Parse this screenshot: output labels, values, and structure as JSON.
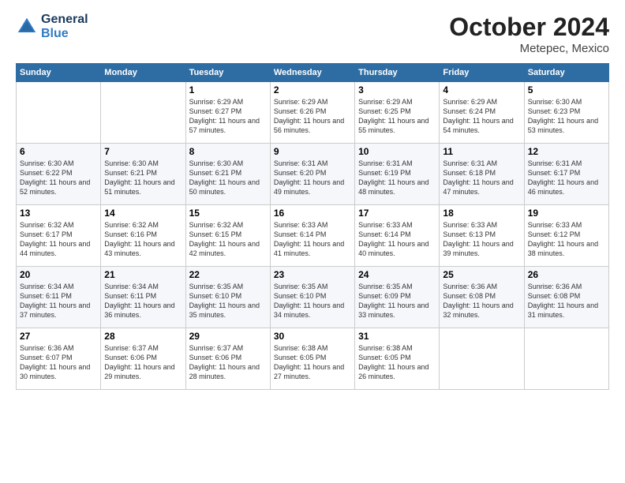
{
  "header": {
    "logo_line1": "General",
    "logo_line2": "Blue",
    "month": "October 2024",
    "location": "Metepec, Mexico"
  },
  "weekdays": [
    "Sunday",
    "Monday",
    "Tuesday",
    "Wednesday",
    "Thursday",
    "Friday",
    "Saturday"
  ],
  "weeks": [
    [
      {
        "day": "",
        "info": ""
      },
      {
        "day": "",
        "info": ""
      },
      {
        "day": "1",
        "info": "Sunrise: 6:29 AM\nSunset: 6:27 PM\nDaylight: 11 hours\nand 57 minutes."
      },
      {
        "day": "2",
        "info": "Sunrise: 6:29 AM\nSunset: 6:26 PM\nDaylight: 11 hours\nand 56 minutes."
      },
      {
        "day": "3",
        "info": "Sunrise: 6:29 AM\nSunset: 6:25 PM\nDaylight: 11 hours\nand 55 minutes."
      },
      {
        "day": "4",
        "info": "Sunrise: 6:29 AM\nSunset: 6:24 PM\nDaylight: 11 hours\nand 54 minutes."
      },
      {
        "day": "5",
        "info": "Sunrise: 6:30 AM\nSunset: 6:23 PM\nDaylight: 11 hours\nand 53 minutes."
      }
    ],
    [
      {
        "day": "6",
        "info": "Sunrise: 6:30 AM\nSunset: 6:22 PM\nDaylight: 11 hours\nand 52 minutes."
      },
      {
        "day": "7",
        "info": "Sunrise: 6:30 AM\nSunset: 6:21 PM\nDaylight: 11 hours\nand 51 minutes."
      },
      {
        "day": "8",
        "info": "Sunrise: 6:30 AM\nSunset: 6:21 PM\nDaylight: 11 hours\nand 50 minutes."
      },
      {
        "day": "9",
        "info": "Sunrise: 6:31 AM\nSunset: 6:20 PM\nDaylight: 11 hours\nand 49 minutes."
      },
      {
        "day": "10",
        "info": "Sunrise: 6:31 AM\nSunset: 6:19 PM\nDaylight: 11 hours\nand 48 minutes."
      },
      {
        "day": "11",
        "info": "Sunrise: 6:31 AM\nSunset: 6:18 PM\nDaylight: 11 hours\nand 47 minutes."
      },
      {
        "day": "12",
        "info": "Sunrise: 6:31 AM\nSunset: 6:17 PM\nDaylight: 11 hours\nand 46 minutes."
      }
    ],
    [
      {
        "day": "13",
        "info": "Sunrise: 6:32 AM\nSunset: 6:17 PM\nDaylight: 11 hours\nand 44 minutes."
      },
      {
        "day": "14",
        "info": "Sunrise: 6:32 AM\nSunset: 6:16 PM\nDaylight: 11 hours\nand 43 minutes."
      },
      {
        "day": "15",
        "info": "Sunrise: 6:32 AM\nSunset: 6:15 PM\nDaylight: 11 hours\nand 42 minutes."
      },
      {
        "day": "16",
        "info": "Sunrise: 6:33 AM\nSunset: 6:14 PM\nDaylight: 11 hours\nand 41 minutes."
      },
      {
        "day": "17",
        "info": "Sunrise: 6:33 AM\nSunset: 6:14 PM\nDaylight: 11 hours\nand 40 minutes."
      },
      {
        "day": "18",
        "info": "Sunrise: 6:33 AM\nSunset: 6:13 PM\nDaylight: 11 hours\nand 39 minutes."
      },
      {
        "day": "19",
        "info": "Sunrise: 6:33 AM\nSunset: 6:12 PM\nDaylight: 11 hours\nand 38 minutes."
      }
    ],
    [
      {
        "day": "20",
        "info": "Sunrise: 6:34 AM\nSunset: 6:11 PM\nDaylight: 11 hours\nand 37 minutes."
      },
      {
        "day": "21",
        "info": "Sunrise: 6:34 AM\nSunset: 6:11 PM\nDaylight: 11 hours\nand 36 minutes."
      },
      {
        "day": "22",
        "info": "Sunrise: 6:35 AM\nSunset: 6:10 PM\nDaylight: 11 hours\nand 35 minutes."
      },
      {
        "day": "23",
        "info": "Sunrise: 6:35 AM\nSunset: 6:10 PM\nDaylight: 11 hours\nand 34 minutes."
      },
      {
        "day": "24",
        "info": "Sunrise: 6:35 AM\nSunset: 6:09 PM\nDaylight: 11 hours\nand 33 minutes."
      },
      {
        "day": "25",
        "info": "Sunrise: 6:36 AM\nSunset: 6:08 PM\nDaylight: 11 hours\nand 32 minutes."
      },
      {
        "day": "26",
        "info": "Sunrise: 6:36 AM\nSunset: 6:08 PM\nDaylight: 11 hours\nand 31 minutes."
      }
    ],
    [
      {
        "day": "27",
        "info": "Sunrise: 6:36 AM\nSunset: 6:07 PM\nDaylight: 11 hours\nand 30 minutes."
      },
      {
        "day": "28",
        "info": "Sunrise: 6:37 AM\nSunset: 6:06 PM\nDaylight: 11 hours\nand 29 minutes."
      },
      {
        "day": "29",
        "info": "Sunrise: 6:37 AM\nSunset: 6:06 PM\nDaylight: 11 hours\nand 28 minutes."
      },
      {
        "day": "30",
        "info": "Sunrise: 6:38 AM\nSunset: 6:05 PM\nDaylight: 11 hours\nand 27 minutes."
      },
      {
        "day": "31",
        "info": "Sunrise: 6:38 AM\nSunset: 6:05 PM\nDaylight: 11 hours\nand 26 minutes."
      },
      {
        "day": "",
        "info": ""
      },
      {
        "day": "",
        "info": ""
      }
    ]
  ]
}
